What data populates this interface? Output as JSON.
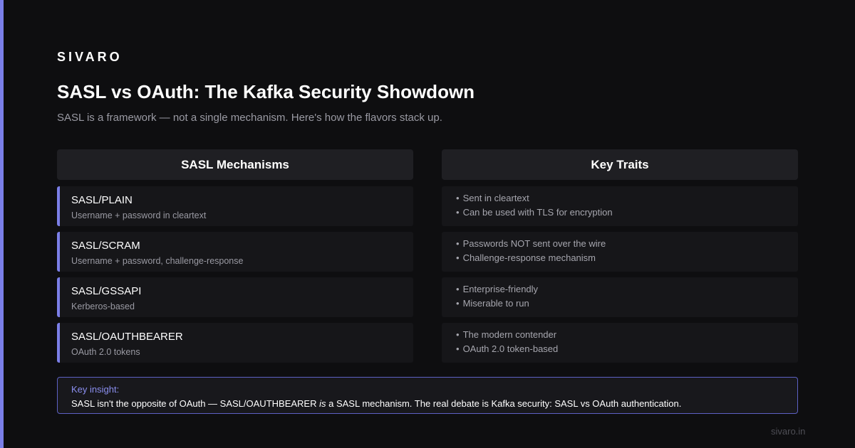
{
  "brand": "SIVARO",
  "title": "SASL vs OAuth: The Kafka Security Showdown",
  "subtitle": "SASL is a framework — not a single mechanism. Here's how the flavors stack up.",
  "columns": {
    "left_header": "SASL Mechanisms",
    "right_header": "Key Traits"
  },
  "mechanisms": [
    {
      "name": "SASL/PLAIN",
      "desc": "Username + password in cleartext",
      "traits": [
        "Sent in cleartext",
        "Can be used with TLS for encryption"
      ]
    },
    {
      "name": "SASL/SCRAM",
      "desc": "Username + password, challenge-response",
      "traits": [
        "Passwords NOT sent over the wire",
        "Challenge-response mechanism"
      ]
    },
    {
      "name": "SASL/GSSAPI",
      "desc": "Kerberos-based",
      "traits": [
        "Enterprise-friendly",
        "Miserable to run"
      ]
    },
    {
      "name": "SASL/OAUTHBEARER",
      "desc": "OAuth 2.0 tokens",
      "traits": [
        "The modern contender",
        "OAuth 2.0 token-based"
      ]
    }
  ],
  "insight": {
    "label": "Key insight:",
    "text_before": "SASL isn't the opposite of OAuth — SASL/OAUTHBEARER ",
    "text_emphasis": "is",
    "text_after": " a SASL mechanism. The real debate is Kafka security: SASL vs OAuth authentication."
  },
  "footer": "sivaro.in",
  "colors": {
    "background": "#0e0e10",
    "accent": "#7b7fe8",
    "panel": "#1f1f23",
    "row": "#161619",
    "muted_text": "#9a9aa3"
  }
}
